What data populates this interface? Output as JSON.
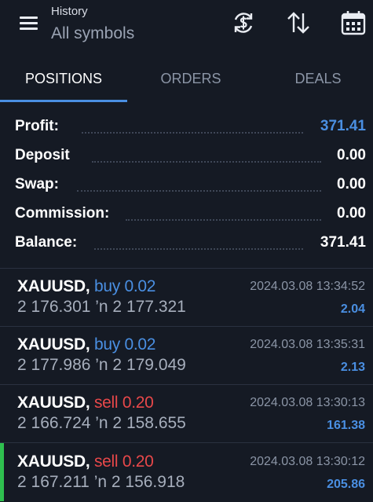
{
  "header": {
    "subtitle": "History",
    "title": "All symbols",
    "icons": [
      "menu-icon",
      "currency-exchange-icon",
      "sort-arrows-icon",
      "calendar-icon"
    ]
  },
  "tabs": [
    {
      "label": "POSITIONS",
      "active": true
    },
    {
      "label": "ORDERS",
      "active": false
    },
    {
      "label": "DEALS",
      "active": false
    }
  ],
  "summary": [
    {
      "label": "Profit:",
      "value": "371.41"
    },
    {
      "label": "Deposit",
      "value": "0.00"
    },
    {
      "label": "Swap:",
      "value": "0.00"
    },
    {
      "label": "Commission:",
      "value": "0.00"
    },
    {
      "label": "Balance:",
      "value": "371.41"
    }
  ],
  "trades": [
    {
      "symbol": "XAUUSD,",
      "side": "buy 0.02",
      "prices": "2 176.301 ’n  2 177.321",
      "time": "2024.03.08 13:34:52",
      "profit": "2.04"
    },
    {
      "symbol": "XAUUSD,",
      "side": "buy 0.02",
      "prices": "2 177.986 ’n  2 179.049",
      "time": "2024.03.08 13:35:31",
      "profit": "2.13"
    },
    {
      "symbol": "XAUUSD,",
      "side": "sell 0.20",
      "prices": "2 166.724 ’n  2 158.655",
      "time": "2024.03.08 13:30:13",
      "profit": "161.38"
    },
    {
      "symbol": "XAUUSD,",
      "side": "sell 0.20",
      "prices": "2 167.211 ’n  2 156.918",
      "time": "2024.03.08 13:30:12",
      "profit": "205.86"
    }
  ],
  "colors": {
    "background": "#151a24",
    "accent_blue": "#4a8fe2",
    "sell_red": "#e8484a",
    "active_green": "#2fbf4f"
  }
}
